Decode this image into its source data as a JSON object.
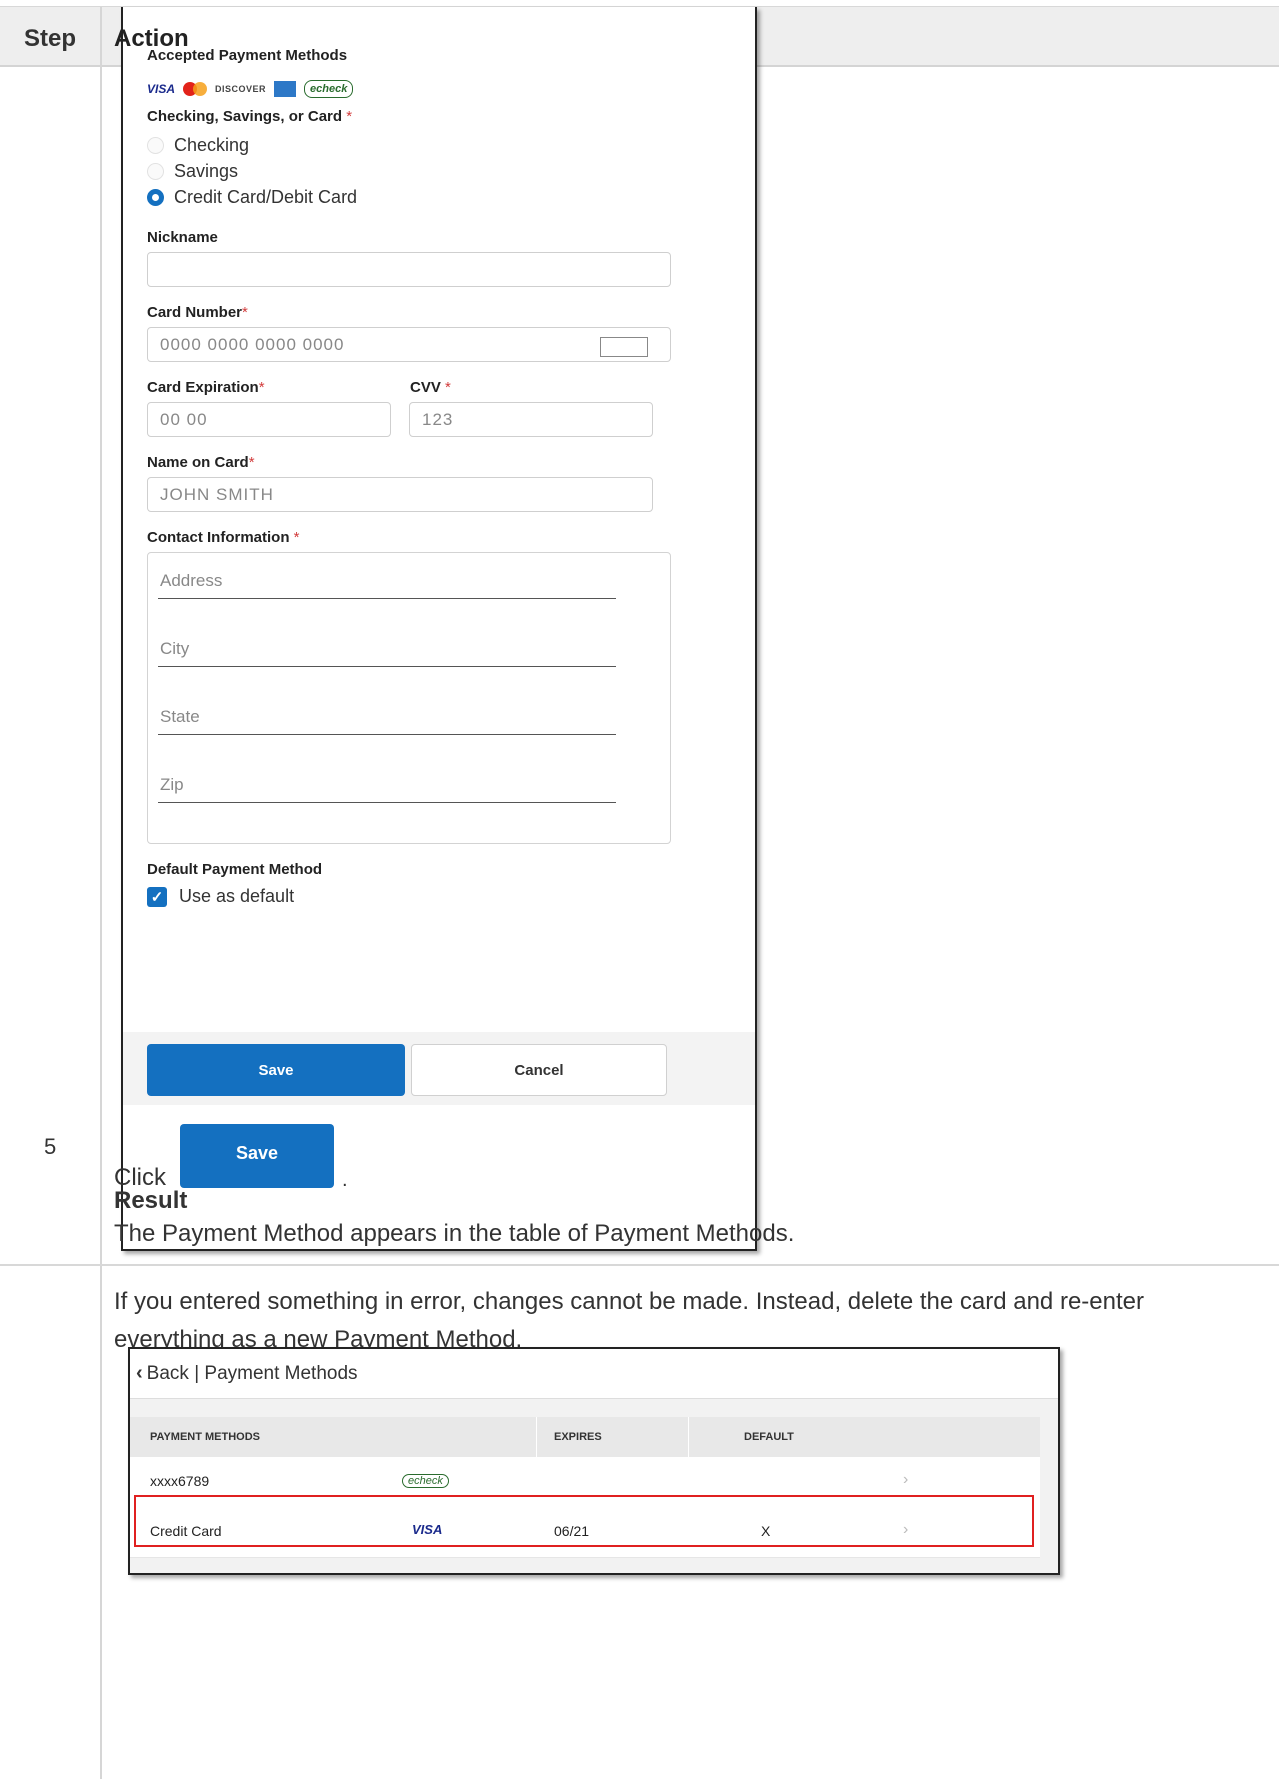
{
  "table_header": {
    "step": "Step",
    "action": "Action"
  },
  "form": {
    "accepted_label": "Accepted Payment Methods",
    "card_icons": {
      "visa": "VISA",
      "discover": "DISCOVER",
      "echeck": "echeck"
    },
    "account_type_label": "Checking, Savings, or Card",
    "account_type_options": [
      "Checking",
      "Savings",
      "Credit Card/Debit Card"
    ],
    "account_type_selected": "Credit Card/Debit Card",
    "nickname_label": "Nickname",
    "nickname_value": "",
    "card_number_label": "Card Number",
    "card_number_placeholder": "0000  0000  0000  0000",
    "card_expiration_label": "Card Expiration",
    "card_expiration_placeholder": "00 00",
    "cvv_label": "CVV",
    "cvv_placeholder": "123",
    "name_on_card_label": "Name on Card",
    "name_on_card_placeholder": "JOHN SMITH",
    "contact_label": "Contact Information",
    "contact_fields": [
      "Address",
      "City",
      "State",
      "Zip"
    ],
    "default_label": "Default Payment Method",
    "default_checkbox_label": "Use as default",
    "default_checked": true,
    "required_mark": "*",
    "save_label": "Save",
    "cancel_label": "Cancel"
  },
  "step5": {
    "number": "5",
    "click_text": "Click",
    "save_button_label": "Save",
    "period": ".",
    "result_title": "Result",
    "result_text": "The Payment Method appears in the table of Payment Methods.",
    "error_text": "If you entered something in error, changes cannot be made. Instead, delete the card and re-enter everything as a new Payment Method."
  },
  "payment_methods": {
    "header": "Back | Payment Methods",
    "columns": [
      "PAYMENT METHODS",
      "EXPIRES",
      "DEFAULT"
    ],
    "rows": [
      {
        "name": "xxxx6789",
        "logo": "echeck",
        "expires": "",
        "default": ""
      },
      {
        "name": "Credit Card",
        "logo": "VISA",
        "expires": "06/21",
        "default": "X"
      }
    ],
    "highlighted_row": 1,
    "highlight_color": "#e02020"
  },
  "colors": {
    "primary_blue": "#1470c0",
    "required_red": "#d23b3b"
  }
}
